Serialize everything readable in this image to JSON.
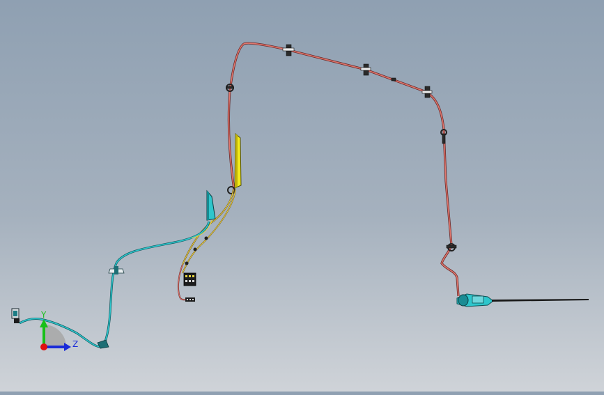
{
  "viewport": {
    "background_top": "#8fa0b2",
    "background_bottom": "#cfd3d8"
  },
  "model": {
    "type": "wire-harness-assembly",
    "harness_colors": {
      "main_harness": "#e0766c",
      "branch_harness": "#2ec6cc",
      "signal_wires": "#e8d640",
      "antenna_rod": "#1a1a1a"
    },
    "components": [
      "main-harness-route",
      "cyan-branch-harness",
      "yellow-connector-panel",
      "cyan-connector-panel",
      "terminal-block",
      "antenna-base",
      "antenna-rod",
      "end-connector",
      "harness-clips"
    ]
  },
  "triad": {
    "y_label": "Y",
    "z_label": "Z",
    "colors": {
      "x": "#e01010",
      "y": "#18c018",
      "z": "#1a2bd8"
    }
  }
}
